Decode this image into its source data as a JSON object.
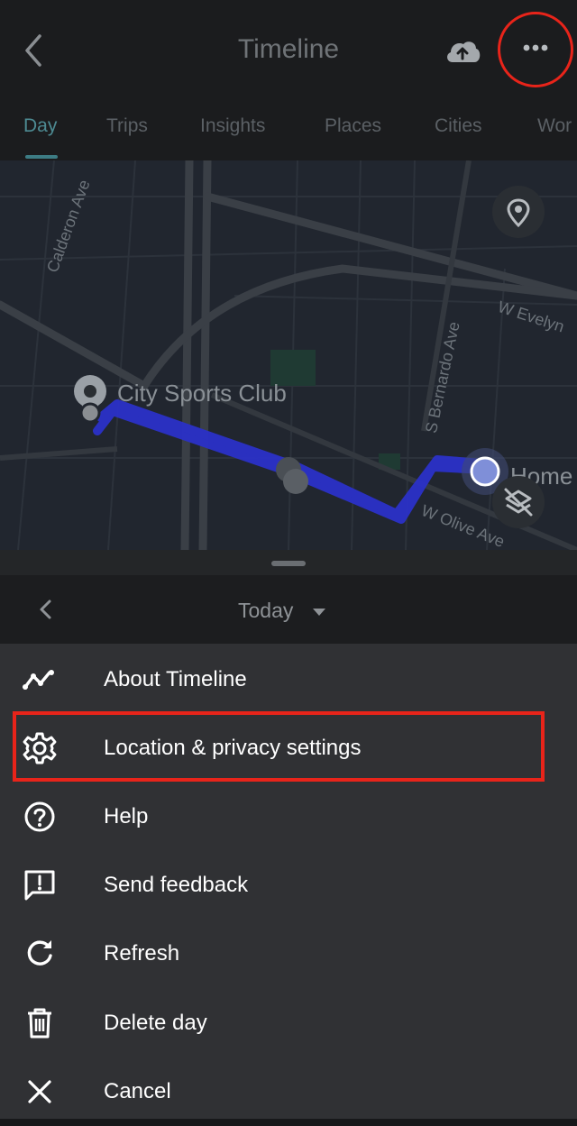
{
  "header": {
    "title": "Timeline",
    "back_icon": "chevron-left-icon",
    "cloud_icon": "cloud-upload-icon",
    "more_icon": "more-horizontal-icon",
    "highlight_color": "#e8241a"
  },
  "tabs": [
    {
      "label": "Day",
      "active": true
    },
    {
      "label": "Trips"
    },
    {
      "label": "Insights"
    },
    {
      "label": "Places"
    },
    {
      "label": "Cities"
    },
    {
      "label": "Wor"
    }
  ],
  "map": {
    "places": {
      "start": "City Sports Club",
      "end": "Home"
    },
    "streets": [
      "Calderon Ave",
      "S Bernardo Ave",
      "W Evelyn",
      "W Olive Ave"
    ],
    "route_color": "#2b31c8",
    "location_icon": "location-pin-icon",
    "layers_off_icon": "layers-off-icon"
  },
  "date_selector": {
    "label": "Today",
    "prev_icon": "chevron-left-icon",
    "caret_icon": "caret-down-icon"
  },
  "menu": [
    {
      "label": "About Timeline",
      "icon": "timeline-icon"
    },
    {
      "label": "Location & privacy settings",
      "icon": "gear-icon",
      "highlighted": true
    },
    {
      "label": "Help",
      "icon": "help-circle-icon"
    },
    {
      "label": "Send feedback",
      "icon": "feedback-icon"
    },
    {
      "label": "Refresh",
      "icon": "refresh-icon"
    },
    {
      "label": "Delete day",
      "icon": "trash-icon"
    },
    {
      "label": "Cancel",
      "icon": "close-icon"
    }
  ]
}
